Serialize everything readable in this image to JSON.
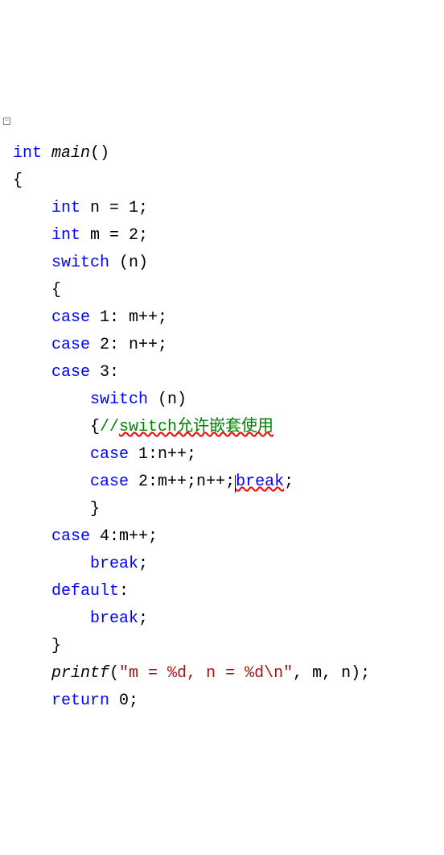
{
  "code": {
    "line1_kw_int": "int",
    "line1_fn": "main",
    "line1_rest": "()",
    "line2": " {",
    "line3_pre": "     ",
    "line3_kw": "int",
    "line3_rest": " n = 1;",
    "line4_pre": "     ",
    "line4_kw": "int",
    "line4_rest": " m = 2;",
    "line5_pre": "     ",
    "line5_kw": "switch",
    "line5_rest": " (n)",
    "line6": "     {",
    "line7_pre": "     ",
    "line7_kw": "case",
    "line7_rest": " 1: m++;",
    "line8_pre": "     ",
    "line8_kw": "case",
    "line8_rest": " 2: n++;",
    "line9_pre": "     ",
    "line9_kw": "case",
    "line9_rest": " 3:",
    "line10_pre": "         ",
    "line10_kw": "switch",
    "line10_rest": " (n)",
    "line11_pre": "         {",
    "line11_comment_slash": "//",
    "line11_comment_text": "switch允许嵌套使用",
    "line12_pre": "         ",
    "line12_kw": "case",
    "line12_rest": " 1:n++;",
    "line13_pre": "         ",
    "line13_kw": "case",
    "line13_mid": " 2:m++;n++;",
    "line13_break": "break",
    "line13_semi": ";",
    "line14": "         }",
    "line15_pre": "     ",
    "line15_kw": "case",
    "line15_rest": " 4:m++;",
    "line16_pre": "         ",
    "line16_kw": "break",
    "line16_rest": ";",
    "line17_pre": "     ",
    "line17_kw": "default",
    "line17_rest": ":",
    "line18_pre": "         ",
    "line18_kw": "break",
    "line18_rest": ";",
    "line19": "     }",
    "line20_pre": "     ",
    "line20_fn": "printf",
    "line20_paren": "(",
    "line20_str": "\"m = %d, n = %d\\n\"",
    "line20_rest": ", m, n);",
    "line21_pre": "     ",
    "line21_kw": "return",
    "line21_rest": " 0;"
  }
}
